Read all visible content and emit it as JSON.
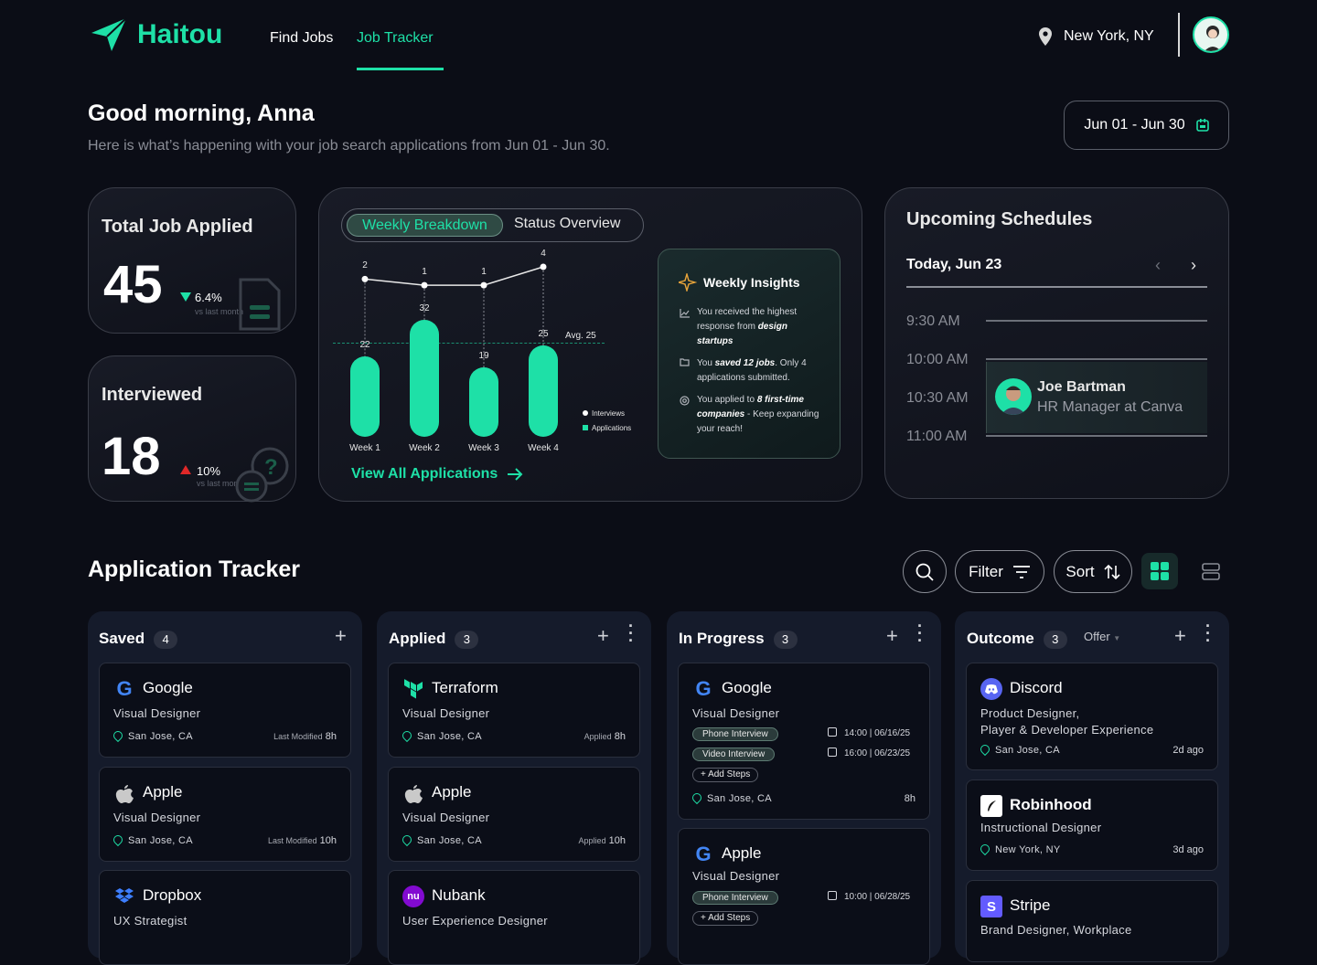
{
  "brand": {
    "name": "Haitou",
    "accent": "#1ee0a7"
  },
  "nav": {
    "items": [
      {
        "label": "Find Jobs"
      },
      {
        "label": "Job Tracker"
      }
    ],
    "location": "New York, NY"
  },
  "greeting": {
    "title": "Good morning, Anna",
    "subtitle": "Here is what’s happening with your job search applications from Jun 01 - Jun 30.",
    "date_range": "Jun 01 - Jun 30"
  },
  "stats": {
    "applied": {
      "title": "Total Job Applied",
      "value": "45",
      "change": "6.4%",
      "note": "vs last month",
      "trend": "down"
    },
    "interviewed": {
      "title": "Interviewed",
      "value": "18",
      "change": "10%",
      "note": "vs last month",
      "trend": "up"
    }
  },
  "breakdown": {
    "tabs": [
      "Weekly Breakdown",
      "Status Overview"
    ],
    "avg_label": "Avg. 25",
    "legend": [
      "Interviews",
      "Applications"
    ],
    "link": "View All Applications"
  },
  "chart_data": {
    "type": "bar",
    "categories": [
      "Week 1",
      "Week 2",
      "Week 3",
      "Week 4"
    ],
    "series": [
      {
        "name": "Applications",
        "values": [
          22,
          32,
          19,
          25
        ]
      },
      {
        "name": "Interviews",
        "values": [
          2,
          1,
          1,
          4
        ]
      }
    ],
    "average": 25
  },
  "insights": {
    "title": "Weekly Insights",
    "items": [
      {
        "pre": "You received the highest response from ",
        "bold": "design startups",
        "post": ""
      },
      {
        "pre": "You ",
        "bold": "saved 12 jobs",
        "post": ". Only 4 applications submitted."
      },
      {
        "pre": "You applied to ",
        "bold": "8 first-time companies",
        "post": " - Keep expanding your reach!"
      }
    ]
  },
  "schedule": {
    "title": "Upcoming Schedules",
    "day": "Today, Jun 23",
    "times": [
      "9:30 AM",
      "10:00 AM",
      "10:30 AM",
      "11:00 AM"
    ],
    "event": {
      "name": "Joe Bartman",
      "role": "HR Manager at Canva"
    }
  },
  "tracker": {
    "title": "Application Tracker",
    "filter": "Filter",
    "sort": "Sort",
    "columns": [
      {
        "title": "Saved",
        "count": "4",
        "cards": [
          {
            "company": "Google",
            "role": "Visual Designer",
            "location": "San Jose, CA",
            "meta_label": "Last Modified",
            "meta": "8h"
          },
          {
            "company": "Apple",
            "role": "Visual Designer",
            "location": "San Jose, CA",
            "meta_label": "Last Modified",
            "meta": "10h"
          },
          {
            "company": "Dropbox",
            "role": "UX Strategist"
          }
        ]
      },
      {
        "title": "Applied",
        "count": "3",
        "cards": [
          {
            "company": "Terraform",
            "role": "Visual Designer",
            "location": "San Jose, CA",
            "meta_label": "Applied",
            "meta": "8h"
          },
          {
            "company": "Apple",
            "role": "Visual Designer",
            "location": "San Jose, CA",
            "meta_label": "Applied",
            "meta": "10h"
          },
          {
            "company": "Nubank",
            "role": "User Experience Designer"
          }
        ]
      },
      {
        "title": "In Progress",
        "count": "3",
        "cards": [
          {
            "company": "Google",
            "role": "Visual Designer",
            "steps": [
              {
                "label": "Phone Interview",
                "when": "14:00 | 06/16/25"
              },
              {
                "label": "Video Interview",
                "when": "16:00 | 06/23/25"
              }
            ],
            "add": "+ Add Steps",
            "location": "San Jose, CA",
            "meta": "8h"
          },
          {
            "company": "Apple",
            "role": "Visual Designer",
            "steps": [
              {
                "label": "Phone Interview",
                "when": "10:00 | 06/28/25"
              }
            ],
            "add": "+ Add Steps"
          }
        ]
      },
      {
        "title": "Outcome",
        "count": "3",
        "dropdown": "Offer",
        "cards": [
          {
            "company": "Discord",
            "role_lines": [
              "Product Designer,",
              "Player & Developer Experience"
            ],
            "location": "San Jose, CA",
            "meta": "2d ago"
          },
          {
            "company": "Robinhood",
            "role": "Instructional Designer",
            "location": "New York, NY",
            "meta": "3d ago"
          },
          {
            "company": "Stripe",
            "role": "Brand Designer, Workplace"
          }
        ]
      }
    ]
  }
}
